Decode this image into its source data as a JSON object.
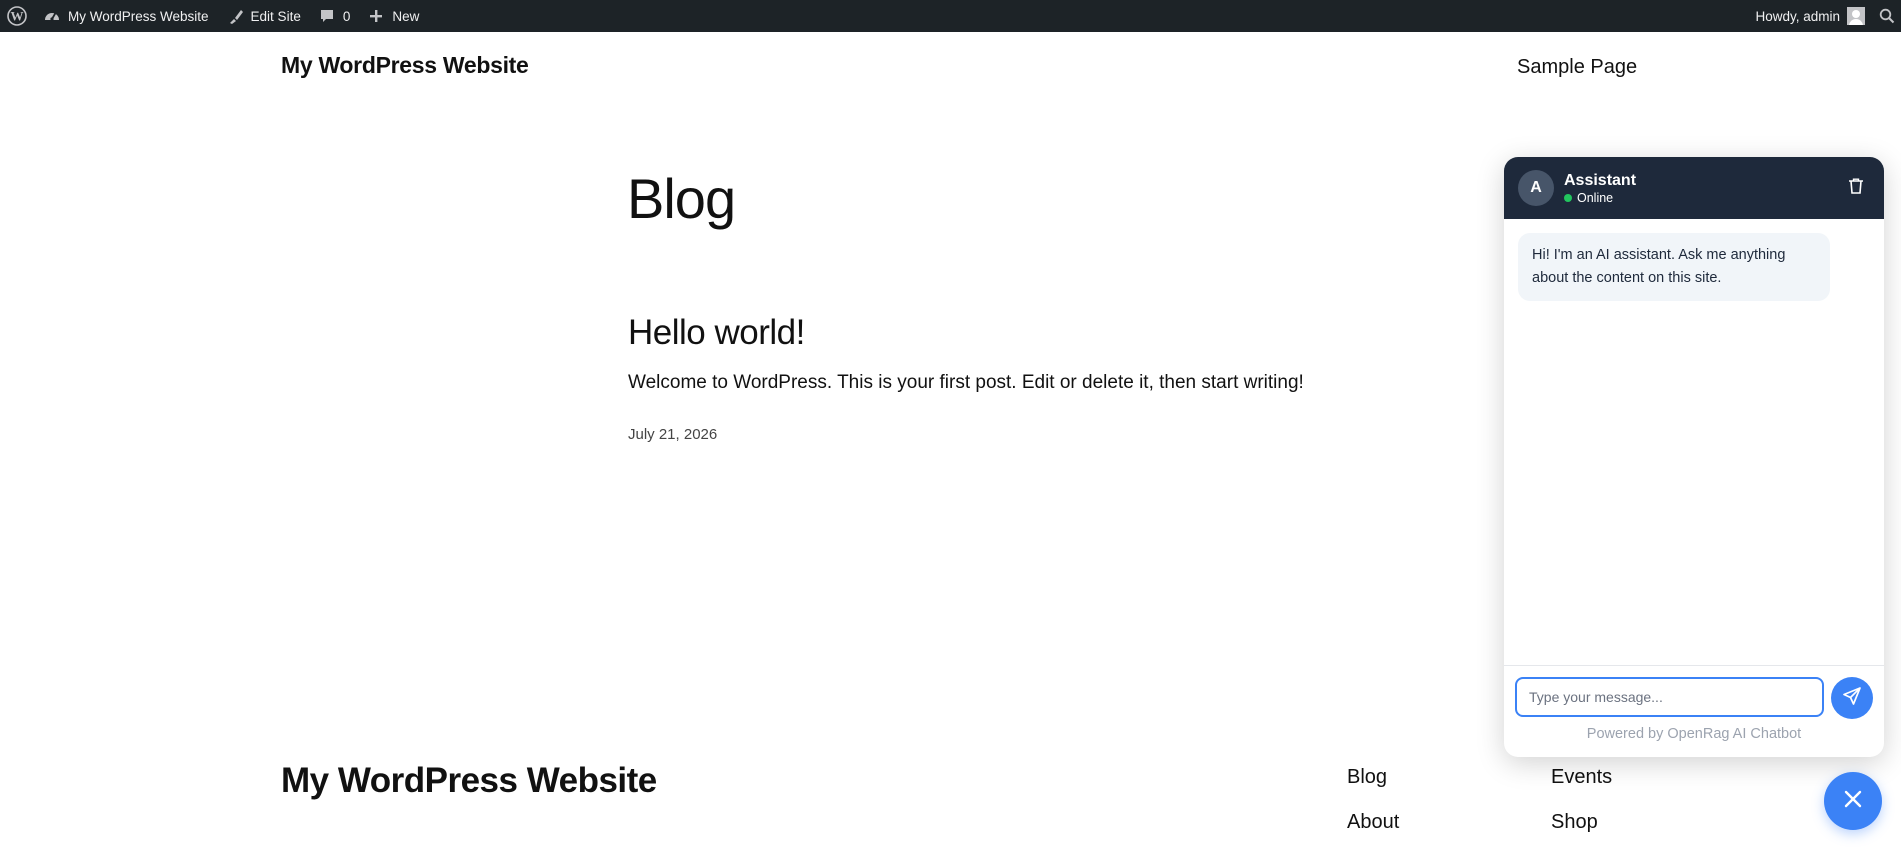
{
  "admin_bar": {
    "site_name": "My WordPress Website",
    "edit_site": "Edit Site",
    "comments_count": "0",
    "new_label": "New",
    "howdy": "Howdy, admin",
    "icons": [
      "wordpress-logo-icon",
      "dashboard-icon",
      "brush-icon",
      "comment-icon",
      "plus-icon",
      "avatar",
      "search-icon"
    ]
  },
  "header": {
    "site_title": "My WordPress Website",
    "nav": [
      "Sample Page"
    ]
  },
  "main": {
    "page_title": "Blog",
    "posts": [
      {
        "title": "Hello world!",
        "excerpt": "Welcome to WordPress. This is your first post. Edit or delete it, then start writing!",
        "date": "July 21, 2026"
      }
    ]
  },
  "footer": {
    "site_title": "My WordPress Website",
    "links": [
      "Blog",
      "Events",
      "About",
      "Shop"
    ]
  },
  "chat": {
    "avatar_letter": "A",
    "name": "Assistant",
    "status": "Online",
    "messages": [
      {
        "from": "assistant",
        "text": "Hi! I'm an AI assistant. Ask me anything about the content on this site."
      }
    ],
    "input_placeholder": "Type your message...",
    "powered_by": "Powered by OpenRag AI Chatbot"
  },
  "colors": {
    "admin_bar_bg": "#1d2327",
    "chat_header_bg": "#1e293b",
    "accent": "#3b82f6",
    "online": "#22c55e"
  }
}
